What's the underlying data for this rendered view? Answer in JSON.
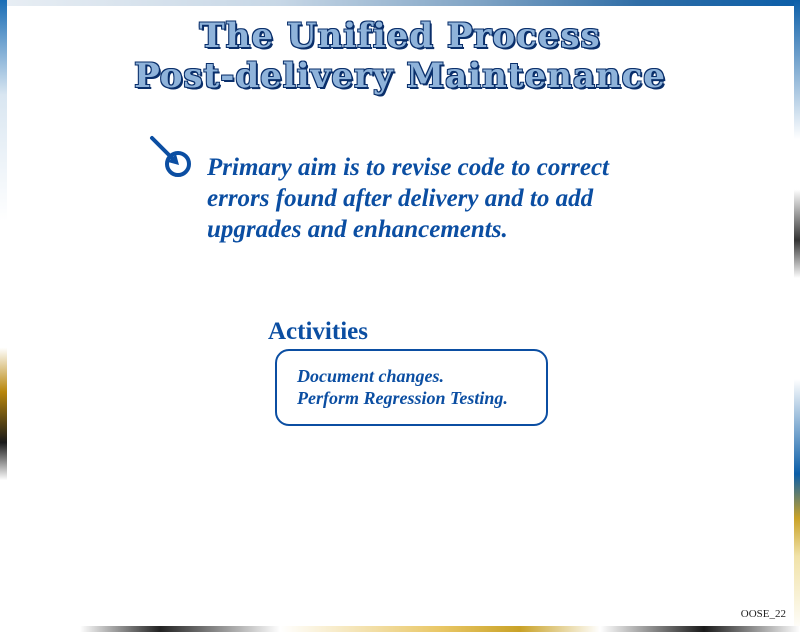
{
  "slide": {
    "title_line1": "The Unified Process",
    "title_line2": "Post-delivery Maintenance",
    "aim_text": "Primary aim is to revise code to correct errors found after delivery and to add upgrades and enhancements.",
    "activities_heading": "Activities",
    "activities": [
      "Document changes.",
      "Perform Regression Testing."
    ],
    "slide_id": "OOSE_22",
    "bullet_icon": "target-arrow-icon",
    "colors": {
      "text_blue": "#0b4ea2",
      "title_fill": "#8fb3da",
      "title_outline": "#0a2f6b"
    }
  }
}
